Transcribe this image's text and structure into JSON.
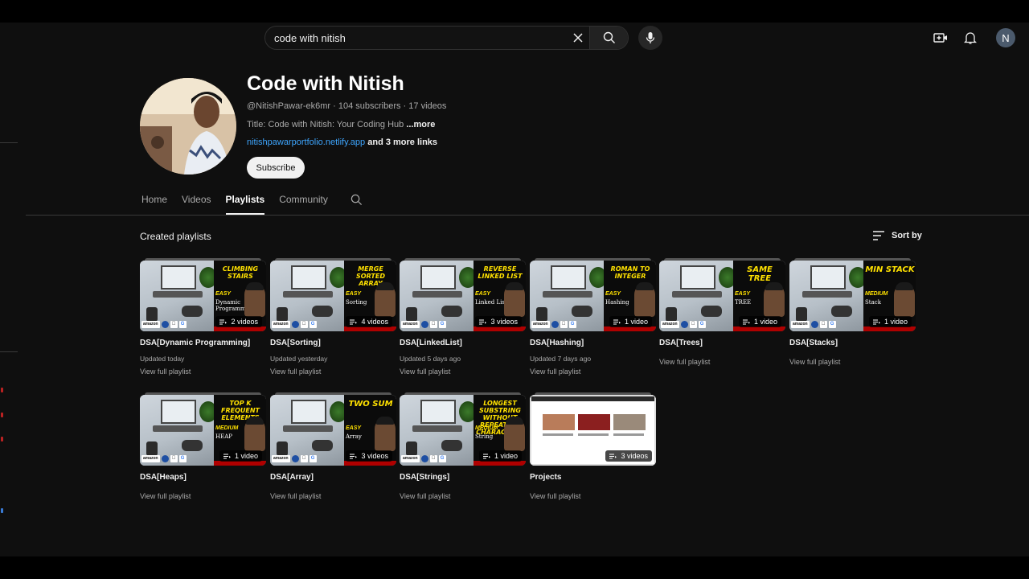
{
  "search": {
    "query": "code with nitish"
  },
  "header": {
    "avatar_letter": "N"
  },
  "channel": {
    "name": "Code with Nitish",
    "meta": "@NitishPawar-ek6mr · 104 subscribers · 17 videos",
    "description": "Title: Code with Nitish: Your Coding Hub",
    "description_more": "...more",
    "link": "nitishpawarportfolio.netlify.app",
    "more_links": "and 3 more links",
    "subscribe_label": "Subscribe"
  },
  "tabs": [
    "Home",
    "Videos",
    "Playlists",
    "Community"
  ],
  "active_tab": "Playlists",
  "section": {
    "title": "Created playlists",
    "sort_label": "Sort by"
  },
  "playlists": [
    {
      "name": "DSA[Dynamic Programming]",
      "updated": "Updated today",
      "count": "2 videos",
      "view": "View full playlist",
      "thumb_title": "CLIMBING STAIRS",
      "difficulty": "EASY",
      "topic": "Dynamic Programming"
    },
    {
      "name": "DSA[Sorting]",
      "updated": "Updated yesterday",
      "count": "4 videos",
      "view": "View full playlist",
      "thumb_title": "MERGE SORTED ARRAY",
      "difficulty": "EASY",
      "topic": "Sorting"
    },
    {
      "name": "DSA[LinkedList]",
      "updated": "Updated 5 days ago",
      "count": "3 videos",
      "view": "View full playlist",
      "thumb_title": "REVERSE LINKED LIST",
      "difficulty": "EASY",
      "topic": "Linked List"
    },
    {
      "name": "DSA[Hashing]",
      "updated": "Updated 7 days ago",
      "count": "1 video",
      "view": "View full playlist",
      "thumb_title": "ROMAN TO INTEGER",
      "difficulty": "EASY",
      "topic": "Hashing"
    },
    {
      "name": "DSA[Trees]",
      "updated": "",
      "count": "1 video",
      "view": "View full playlist",
      "thumb_title": "SAME TREE",
      "difficulty": "EASY",
      "topic": "TREE"
    },
    {
      "name": "DSA[Stacks]",
      "updated": "",
      "count": "1 video",
      "view": "View full playlist",
      "thumb_title": "MIN STACK",
      "difficulty": "MEDIUM",
      "topic": "Stack"
    },
    {
      "name": "DSA[Heaps]",
      "updated": "",
      "count": "1 video",
      "view": "View full playlist",
      "thumb_title": "TOP K FREQUENT ELEMENTS",
      "difficulty": "MEDIUM",
      "topic": "HEAP"
    },
    {
      "name": "DSA[Array]",
      "updated": "",
      "count": "3 videos",
      "view": "View full playlist",
      "thumb_title": "TWO SUM",
      "difficulty": "EASY",
      "topic": "Array"
    },
    {
      "name": "DSA[Strings]",
      "updated": "",
      "count": "1 video",
      "view": "View full playlist",
      "thumb_title": "LONGEST SUBSTRING WITHOUT REPEATING CHARACTERS",
      "difficulty": "MEDIUM",
      "topic": "String"
    },
    {
      "name": "Projects",
      "updated": "",
      "count": "3 videos",
      "view": "View full playlist",
      "thumb_title": "",
      "difficulty": "",
      "topic": ""
    }
  ],
  "colors": {
    "accent_link": "#3ea6ff",
    "thumb_title": "#ffe100",
    "background": "#0f0f0f"
  }
}
